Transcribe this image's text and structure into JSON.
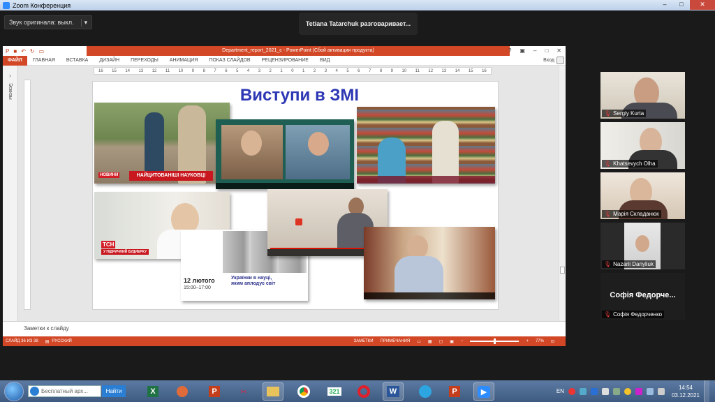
{
  "zoom": {
    "window_title": "Zoom Конференция",
    "audio_button": "Звук оригинала: выкл.",
    "audio_dropdown": "▾",
    "speaker_label": "Tetiana Tatarchuk разговаривает..."
  },
  "powerpoint": {
    "title": "Department_report_2021_c - PowerPoint (Сбой активации продукта)",
    "qat_icons": [
      "save-icon",
      "undo-icon",
      "redo-icon",
      "present-icon"
    ],
    "file_tab": "ФАЙЛ",
    "tabs": [
      "ГЛАВНАЯ",
      "ВСТАВКА",
      "ДИЗАЙН",
      "ПЕРЕХОДЫ",
      "АНИМАЦИЯ",
      "ПОКАЗ СЛАЙДОВ",
      "РЕЦЕНЗИРОВАНИЕ",
      "ВИД"
    ],
    "signin": "Вход",
    "thumb_pane_label": "Эскизы",
    "ruler_marks": [
      "16",
      "15",
      "14",
      "13",
      "12",
      "11",
      "10",
      "9",
      "8",
      "7",
      "6",
      "5",
      "4",
      "3",
      "2",
      "1",
      "0",
      "1",
      "2",
      "3",
      "4",
      "5",
      "6",
      "7",
      "8",
      "9",
      "10",
      "11",
      "12",
      "13",
      "14",
      "15",
      "16"
    ],
    "notes_placeholder": "Заметки к слайду",
    "status": {
      "slide_info": "СЛАЙД 36 ИЗ 38",
      "language": "РУССКИЙ",
      "notes_btn": "ЗАМЕТКИ",
      "comments_btn": "ПРИМЕЧАНИЯ",
      "zoom_minus": "−",
      "zoom_plus": "+",
      "zoom_level": "77%"
    }
  },
  "slide": {
    "title": "Виступи в ЗМІ",
    "photo1_caption": "НАЙЦИТОВАНІШІ НАУКОВЦІ",
    "photo1_logo": "НОВИНИ",
    "photo3_logo": "TCH",
    "photo3_caption": "У ПІДРИЧНИЙ БУДИЕРКУ",
    "poster_date": "12 лютого",
    "poster_time": "15:00–17:00",
    "poster_title": "Українки в науці, яким аплодує світ"
  },
  "participants": [
    {
      "name": "Sergiy Kurta",
      "muted": true
    },
    {
      "name": "Khatsevych Olha",
      "muted": true
    },
    {
      "name": "Марія Складанюк",
      "muted": true
    },
    {
      "name": "Nazarii Danyliuk",
      "muted": true
    },
    {
      "name": "Софія Федорченко",
      "display_title": "Софія Федорче...",
      "muted": true
    }
  ],
  "taskbar": {
    "search_placeholder": "Бесплатный арх...",
    "search_button": "Найти",
    "apps": [
      "excel-icon",
      "files-icon",
      "powerpoint-icon",
      "paint-icon",
      "explorer-icon",
      "chrome-icon",
      "calendar-icon",
      "opera-icon",
      "word-icon",
      "telegram-icon",
      "zoom-icon"
    ],
    "calendar_day": "321",
    "language": "EN",
    "time": "14:54",
    "date": "03.12.2021"
  }
}
